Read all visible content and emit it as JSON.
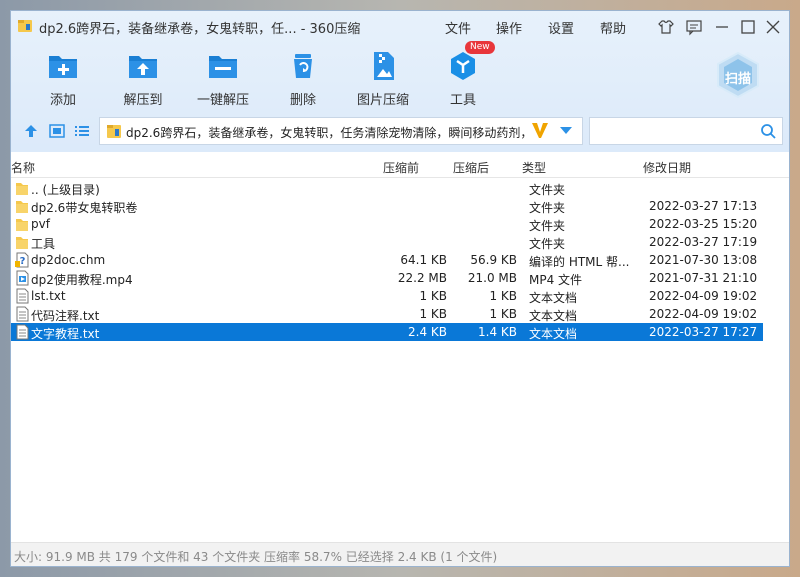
{
  "window": {
    "title": "dp2.6跨界石，装备继承卷，女鬼转职，任... - 360压缩",
    "menu": [
      "文件",
      "操作",
      "设置",
      "帮助"
    ]
  },
  "toolbar": {
    "tools": [
      "添加",
      "解压到",
      "一键解压",
      "删除",
      "图片压缩",
      "工具"
    ],
    "new_badge": "New",
    "scan_label": "扫描"
  },
  "address": {
    "path": "dp2.6跨界石，装备继承卷，女鬼转职，任务清除宠物清除，瞬间移动药剂，-"
  },
  "columns": {
    "name": "名称",
    "compressed": "压缩前",
    "packed": "压缩后",
    "type": "类型",
    "modified": "修改日期"
  },
  "files": [
    {
      "name": ".. (上级目录)",
      "size": "",
      "packed": "",
      "type": "文件夹",
      "date": "",
      "icon": "folder-icon"
    },
    {
      "name": "dp2.6带女鬼转职卷",
      "size": "",
      "packed": "",
      "type": "文件夹",
      "date": "2022-03-27 17:13",
      "icon": "folder-icon"
    },
    {
      "name": "pvf",
      "size": "",
      "packed": "",
      "type": "文件夹",
      "date": "2022-03-25 15:20",
      "icon": "folder-icon"
    },
    {
      "name": "工具",
      "size": "",
      "packed": "",
      "type": "文件夹",
      "date": "2022-03-27 17:19",
      "icon": "folder-icon"
    },
    {
      "name": "dp2doc.chm",
      "size": "64.1 KB",
      "packed": "56.9 KB",
      "type": "编译的 HTML 帮...",
      "date": "2021-07-30 13:08",
      "icon": "help-file-icon"
    },
    {
      "name": "dp2使用教程.mp4",
      "size": "22.2 MB",
      "packed": "21.0 MB",
      "type": "MP4 文件",
      "date": "2021-07-31 21:10",
      "icon": "video-file-icon"
    },
    {
      "name": "lst.txt",
      "size": "1 KB",
      "packed": "1 KB",
      "type": "文本文档",
      "date": "2022-04-09 19:02",
      "icon": "text-file-icon"
    },
    {
      "name": "代码注释.txt",
      "size": "1 KB",
      "packed": "1 KB",
      "type": "文本文档",
      "date": "2022-04-09 19:02",
      "icon": "text-file-icon"
    },
    {
      "name": "文字教程.txt",
      "size": "2.4 KB",
      "packed": "1.4 KB",
      "type": "文本文档",
      "date": "2022-03-27 17:27",
      "icon": "text-file-icon",
      "selected": true
    }
  ],
  "status": "大小: 91.9 MB 共 179 个文件和 43 个文件夹 压缩率 58.7% 已经选择 2.4 KB (1 个文件)",
  "colors": {
    "accent": "#1a7fd4",
    "selection": "#0a78d7",
    "folder": "#f5c84c",
    "toolbar_bg": "#e2eefb"
  }
}
